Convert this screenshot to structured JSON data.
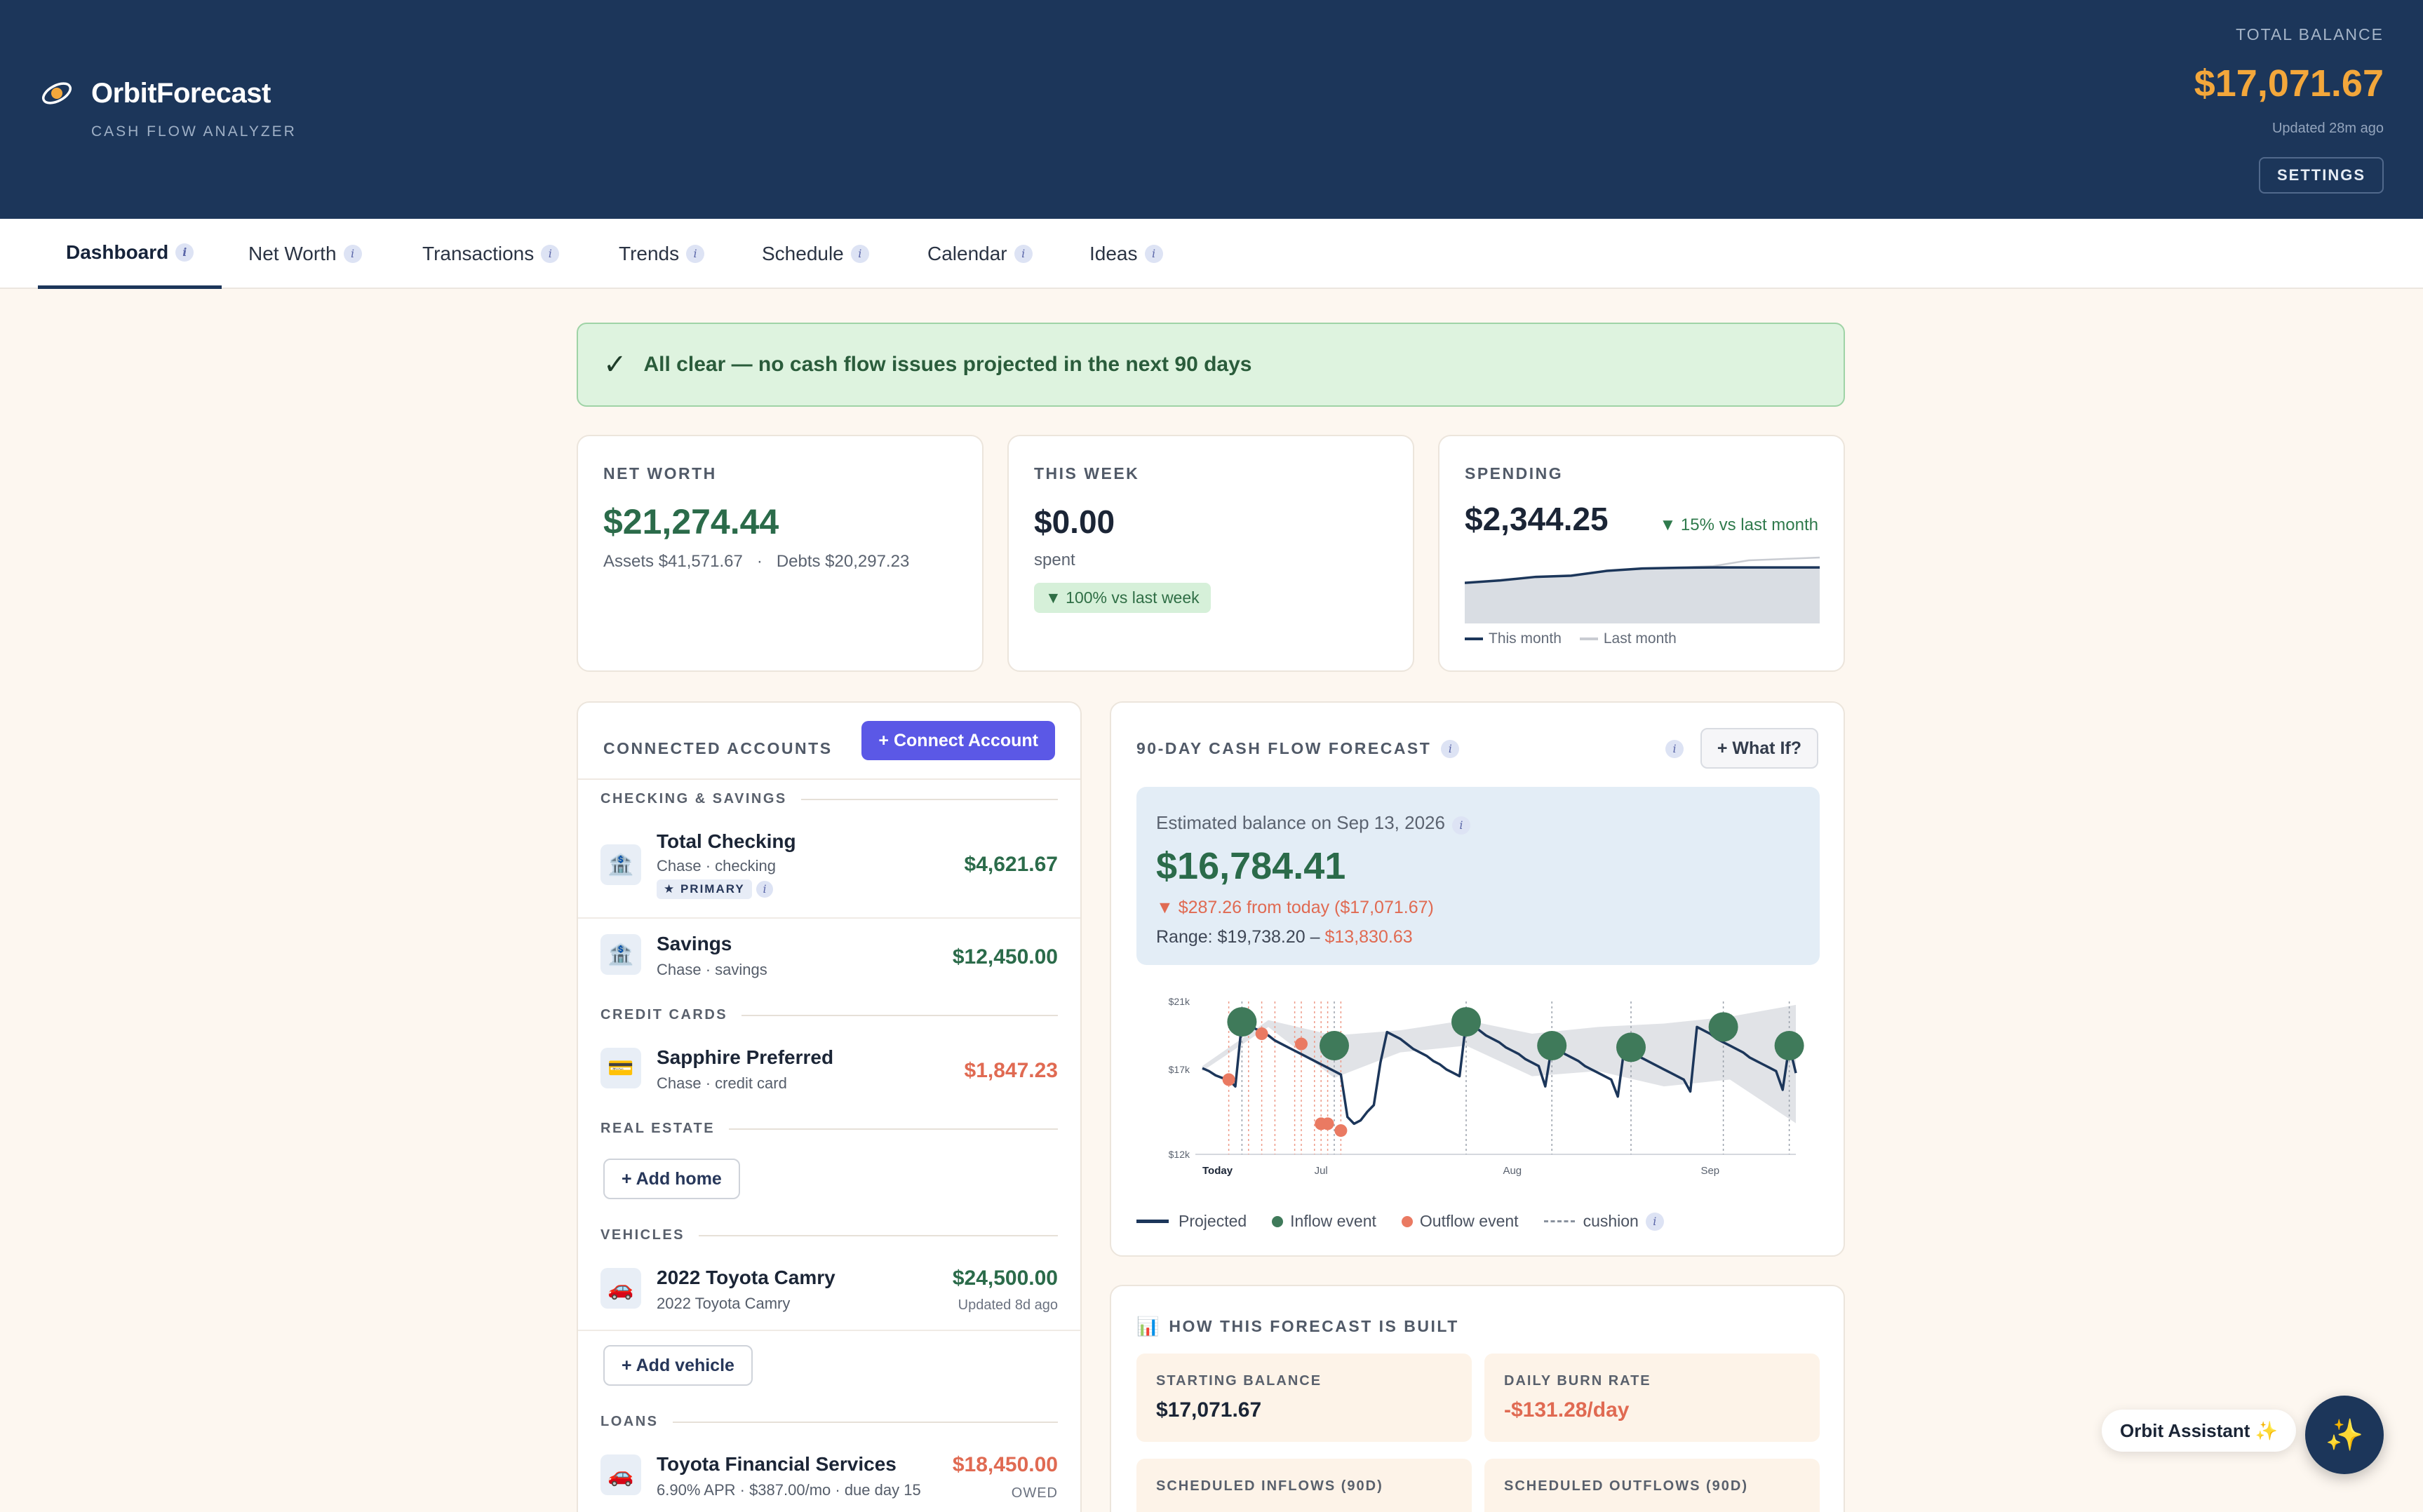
{
  "app": {
    "name": "OrbitForecast",
    "subtitle": "CASH FLOW ANALYZER",
    "balance_label": "TOTAL BALANCE",
    "balance_value": "$17,071.67",
    "balance_updated": "Updated 28m ago",
    "settings_label": "SETTINGS"
  },
  "tabs": [
    {
      "label": "Dashboard",
      "active": true
    },
    {
      "label": "Net Worth"
    },
    {
      "label": "Transactions"
    },
    {
      "label": "Trends"
    },
    {
      "label": "Schedule"
    },
    {
      "label": "Calendar"
    },
    {
      "label": "Ideas"
    }
  ],
  "info_glyph": "i",
  "alert": {
    "icon": "✓",
    "text": "All clear — no cash flow issues projected in the next 90 days"
  },
  "net_worth": {
    "label": "NET WORTH",
    "value": "$21,274.44",
    "assets": "Assets $41,571.67",
    "sep": "·",
    "debts": "Debts $20,297.23"
  },
  "this_week": {
    "label": "THIS WEEK",
    "value": "$0.00",
    "sub": "spent",
    "badge": "▼ 100% vs last week"
  },
  "spending": {
    "label": "SPENDING",
    "value": "$2,344.25",
    "delta": "▼ 15% vs last month",
    "legend_this": "This month",
    "legend_last": "Last month",
    "colors": {
      "this_month": "#1c365a",
      "last_month": "#c9ccd2",
      "fill": "#d9dde3"
    }
  },
  "accounts": {
    "title": "CONNECTED ACCOUNTS",
    "connect_label": "+ Connect Account",
    "sections": {
      "checking": "CHECKING & SAVINGS",
      "credit": "CREDIT CARDS",
      "real_estate": "REAL ESTATE",
      "vehicles": "VEHICLES",
      "loans": "LOANS"
    },
    "items": {
      "checking": {
        "icon": "bank-icon",
        "name": "Total Checking",
        "meta": "Chase · checking",
        "badge": "★ PRIMARY",
        "amount": "$4,621.67"
      },
      "savings": {
        "icon": "bank-icon",
        "name": "Savings",
        "meta": "Chase · savings",
        "amount": "$12,450.00"
      },
      "sapphire": {
        "icon": "credit-card-icon",
        "name": "Sapphire Preferred",
        "meta": "Chase · credit card",
        "amount": "$1,847.23"
      },
      "camry": {
        "icon": "car-icon",
        "name": "2022 Toyota Camry",
        "meta": "2022 Toyota Camry",
        "amount": "$24,500.00",
        "note": "Updated 8d ago"
      },
      "loan": {
        "icon": "car-icon",
        "name": "Toyota Financial Services",
        "meta": "6.90% APR · $387.00/mo · due day 15",
        "amount": "$18,450.00",
        "note": "OWED"
      }
    },
    "add_home": "+ Add home",
    "add_vehicle": "+ Add vehicle"
  },
  "forecast": {
    "title": "90-DAY CASH FLOW FORECAST",
    "whatif_label": "+ What If?",
    "est_label": "Estimated balance on Sep 13, 2026",
    "est_value": "$16,784.41",
    "est_delta": "▼ $287.26 from today ($17,071.67)",
    "range_prefix": "Range: $19,738.20 –",
    "range_low": "$13,830.63",
    "legend": {
      "projected": "Projected",
      "inflow": "Inflow event",
      "outflow": "Outflow event",
      "cushion": "cushion"
    },
    "colors": {
      "line": "#1c365a",
      "inflow": "#3f7a5a",
      "outflow": "#ea7a62",
      "band": "#c8ccd4"
    }
  },
  "built": {
    "emoji": "📊",
    "title": "HOW THIS FORECAST IS BUILT",
    "stats": {
      "starting": {
        "label": "STARTING BALANCE",
        "value": "$17,071.67"
      },
      "burn": {
        "label": "DAILY BURN RATE",
        "value": "-$131.28/day"
      },
      "inflows": {
        "label": "SCHEDULED INFLOWS (90D)"
      },
      "outflows": {
        "label": "SCHEDULED OUTFLOWS (90D)"
      }
    }
  },
  "assistant": {
    "label": "Orbit Assistant ✨",
    "icon": "✨"
  },
  "chart_data": [
    {
      "type": "line",
      "title": "90-DAY CASH FLOW FORECAST",
      "x_tick_labels": [
        "Today",
        "Jul",
        "Aug",
        "Sep"
      ],
      "y_tick_labels": [
        "$21k",
        "$17k",
        "$12k"
      ],
      "ylim": [
        12000,
        21000
      ],
      "series": [
        {
          "name": "Projected",
          "x": [
            0,
            1,
            2,
            3,
            4,
            5,
            6,
            7,
            8,
            9,
            10,
            11,
            12,
            13,
            14,
            15,
            16,
            17,
            18,
            19,
            20,
            21,
            22,
            23,
            24,
            25,
            26,
            27,
            28,
            29,
            30,
            31,
            32,
            33,
            34,
            35,
            36,
            37,
            38,
            39,
            40,
            41,
            42,
            43,
            44,
            45,
            46,
            47,
            48,
            49,
            50,
            51,
            52,
            53,
            54,
            55,
            56,
            57,
            58,
            59,
            60,
            61,
            62,
            63,
            64,
            65,
            66,
            67,
            68,
            69,
            70,
            71,
            72,
            73,
            74,
            75,
            76,
            77,
            78,
            79,
            80,
            81,
            82,
            83,
            84,
            85,
            86,
            87,
            88,
            89,
            90
          ],
          "values": [
            17071,
            16900,
            16650,
            16500,
            16400,
            16000,
            19800,
            19700,
            19400,
            19200,
            19000,
            18700,
            18500,
            18300,
            18100,
            17900,
            17700,
            17500,
            17300,
            17100,
            16900,
            16700,
            14200,
            13800,
            14000,
            14500,
            14900,
            17400,
            19200,
            19000,
            18800,
            18500,
            18200,
            18000,
            17800,
            17500,
            17300,
            17000,
            16800,
            16600,
            19800,
            19600,
            19300,
            19000,
            18800,
            18600,
            18300,
            18100,
            17900,
            17600,
            17400,
            17200,
            16000,
            18400,
            18200,
            17900,
            17700,
            17500,
            17200,
            17000,
            16800,
            16600,
            16400,
            15400,
            18300,
            18100,
            17800,
            17600,
            17400,
            17200,
            17000,
            16800,
            16600,
            16400,
            15700,
            19500,
            19300,
            19100,
            18800,
            18600,
            18400,
            18200,
            18000,
            17700,
            17500,
            17300,
            17100,
            16900,
            15800,
            18400,
            16784
          ]
        }
      ],
      "cushion_band": {
        "x": [
          0,
          10,
          20,
          30,
          40,
          50,
          60,
          70,
          80,
          90
        ],
        "upper": [
          17200,
          19900,
          19000,
          19300,
          19900,
          19100,
          19500,
          19700,
          20100,
          20800
        ],
        "lower": [
          16900,
          19500,
          16500,
          18000,
          18400,
          16600,
          16900,
          16000,
          16400,
          13830
        ]
      },
      "inflow_events": [
        {
          "x": 6,
          "y": 19800
        },
        {
          "x": 20,
          "y": 18400
        },
        {
          "x": 40,
          "y": 19800
        },
        {
          "x": 53,
          "y": 18400
        },
        {
          "x": 65,
          "y": 18300
        },
        {
          "x": 79,
          "y": 19500
        },
        {
          "x": 89,
          "y": 18400
        }
      ],
      "outflow_events": [
        {
          "x": 4,
          "y": 16400
        },
        {
          "x": 9,
          "y": 19100
        },
        {
          "x": 15,
          "y": 18500
        },
        {
          "x": 18,
          "y": 13800
        },
        {
          "x": 19,
          "y": 13800
        },
        {
          "x": 20,
          "y": 18800
        },
        {
          "x": 21,
          "y": 13400
        }
      ],
      "event_lines_x": [
        4,
        6,
        7,
        9,
        11,
        14,
        15,
        17,
        18,
        19,
        20,
        21,
        40,
        53,
        65,
        79,
        89
      ]
    },
    {
      "type": "area",
      "title": "Spending",
      "series": [
        {
          "name": "This month",
          "x": [
            0,
            1,
            2,
            3,
            4,
            5,
            6,
            7,
            8,
            9,
            10
          ],
          "values": [
            1700,
            1800,
            1950,
            2000,
            2200,
            2300,
            2330,
            2344,
            2344,
            2344,
            2344
          ]
        },
        {
          "name": "Last month",
          "x": [
            0,
            1,
            2,
            3,
            4,
            5,
            6,
            7,
            8,
            9,
            10
          ],
          "values": [
            1700,
            1800,
            1950,
            2000,
            2200,
            2300,
            2340,
            2400,
            2640,
            2700,
            2760
          ]
        }
      ]
    }
  ]
}
